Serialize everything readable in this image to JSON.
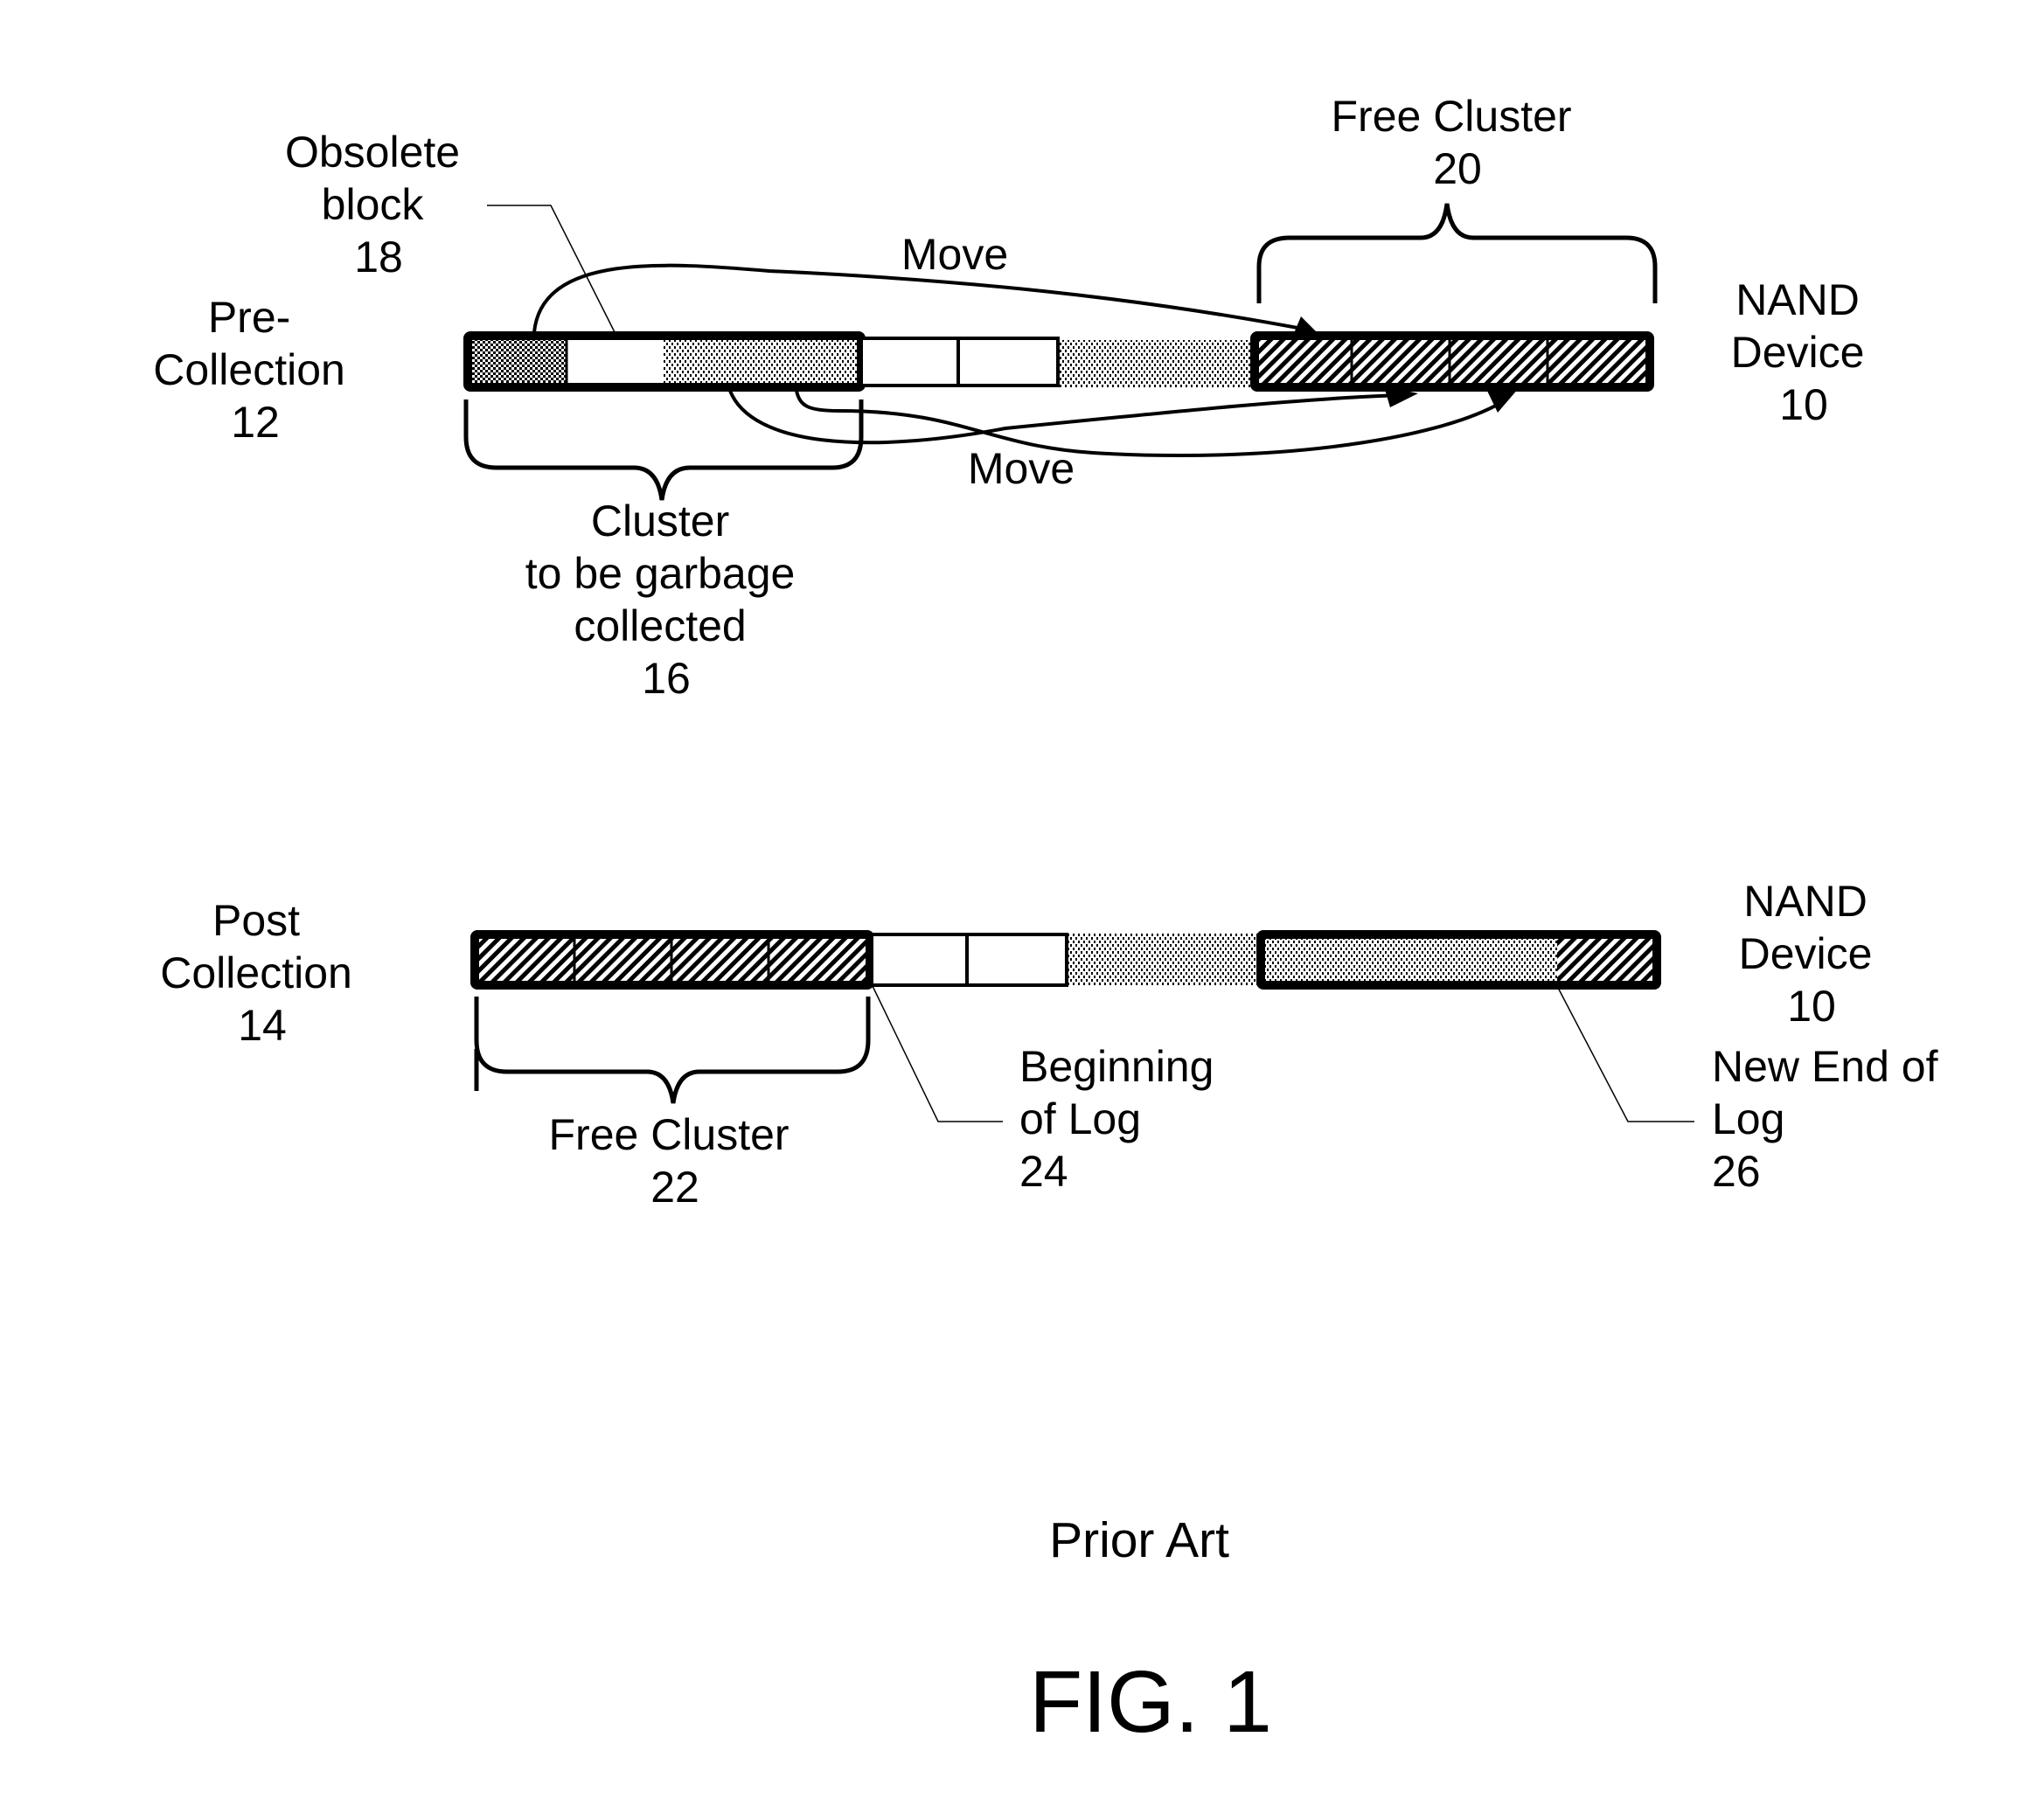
{
  "figure": {
    "caption": "Prior Art",
    "title": "FIG. 1"
  },
  "pre_collection": {
    "state_label": [
      "Pre-",
      "Collection",
      "12"
    ],
    "device_label": [
      "NAND",
      "Device",
      "10"
    ],
    "obsolete_block_label": [
      "Obsolete",
      "block",
      "18"
    ],
    "free_cluster_label": [
      "Free Cluster",
      "20"
    ],
    "gc_cluster_label": [
      "Cluster",
      "to be garbage",
      "collected",
      "16"
    ],
    "move_labels": [
      "Move",
      "Move"
    ],
    "blocks": [
      {
        "state": "valid",
        "pattern": "dotted"
      },
      {
        "state": "obsolete",
        "pattern": "empty"
      },
      {
        "state": "valid",
        "pattern": "dotted"
      },
      {
        "state": "valid",
        "pattern": "dotted"
      },
      {
        "state": "free",
        "pattern": "empty"
      },
      {
        "state": "free",
        "pattern": "empty"
      },
      {
        "state": "log",
        "pattern": "dotted"
      },
      {
        "state": "moved",
        "pattern": "hatched"
      },
      {
        "state": "moved",
        "pattern": "hatched"
      },
      {
        "state": "moved",
        "pattern": "hatched"
      },
      {
        "state": "moved",
        "pattern": "hatched"
      }
    ]
  },
  "post_collection": {
    "state_label": [
      "Post",
      "Collection",
      "14"
    ],
    "device_label": [
      "NAND",
      "Device",
      "10"
    ],
    "free_cluster_label": [
      "Free Cluster",
      "22"
    ],
    "beginning_of_log_label": [
      "Beginning",
      "of Log",
      "24"
    ],
    "new_end_of_log_label": [
      "New End of",
      "Log",
      "26"
    ]
  },
  "colors": {
    "ink": "#000000",
    "background": "#ffffff"
  }
}
